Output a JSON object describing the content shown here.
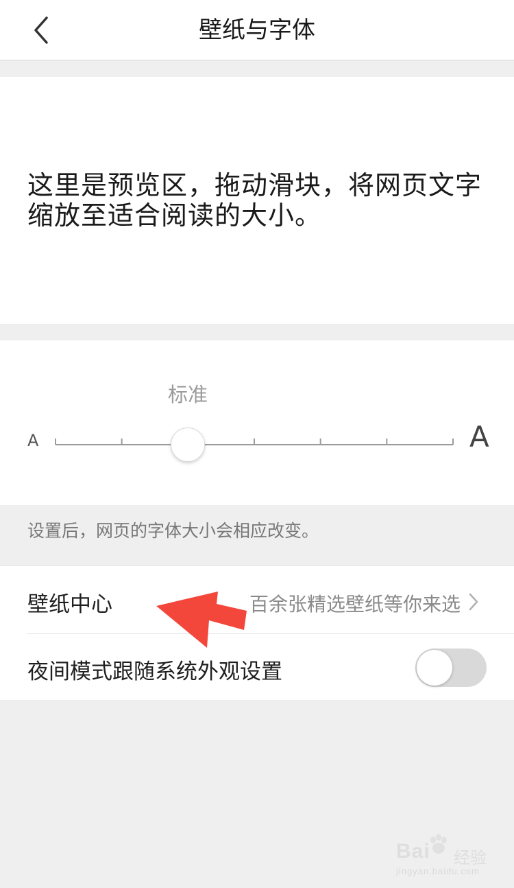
{
  "header": {
    "title": "壁纸与字体",
    "back_icon": "chevron-left-icon"
  },
  "preview": {
    "text": "这里是预览区，拖动滑块，将网页文字缩放至适合阅读的大小。"
  },
  "font_size": {
    "level_label": "标准",
    "small_label": "A",
    "large_label": "A",
    "steps": 7,
    "selected_step": 2
  },
  "hint": "设置后，网页的字体大小会相应改变。",
  "settings": {
    "wallpaper": {
      "label": "壁纸中心",
      "value": "百余张精选壁纸等你来选",
      "icon": "chevron-right-icon"
    },
    "night_mode": {
      "label": "夜间模式跟随系统外观设置",
      "enabled": false
    }
  },
  "annotation": {
    "icon": "arrow-icon",
    "color": "#f2473a"
  },
  "watermark": {
    "brand": "Bai",
    "brand_suffix": "经验",
    "url": "jingyan.baidu.com"
  }
}
